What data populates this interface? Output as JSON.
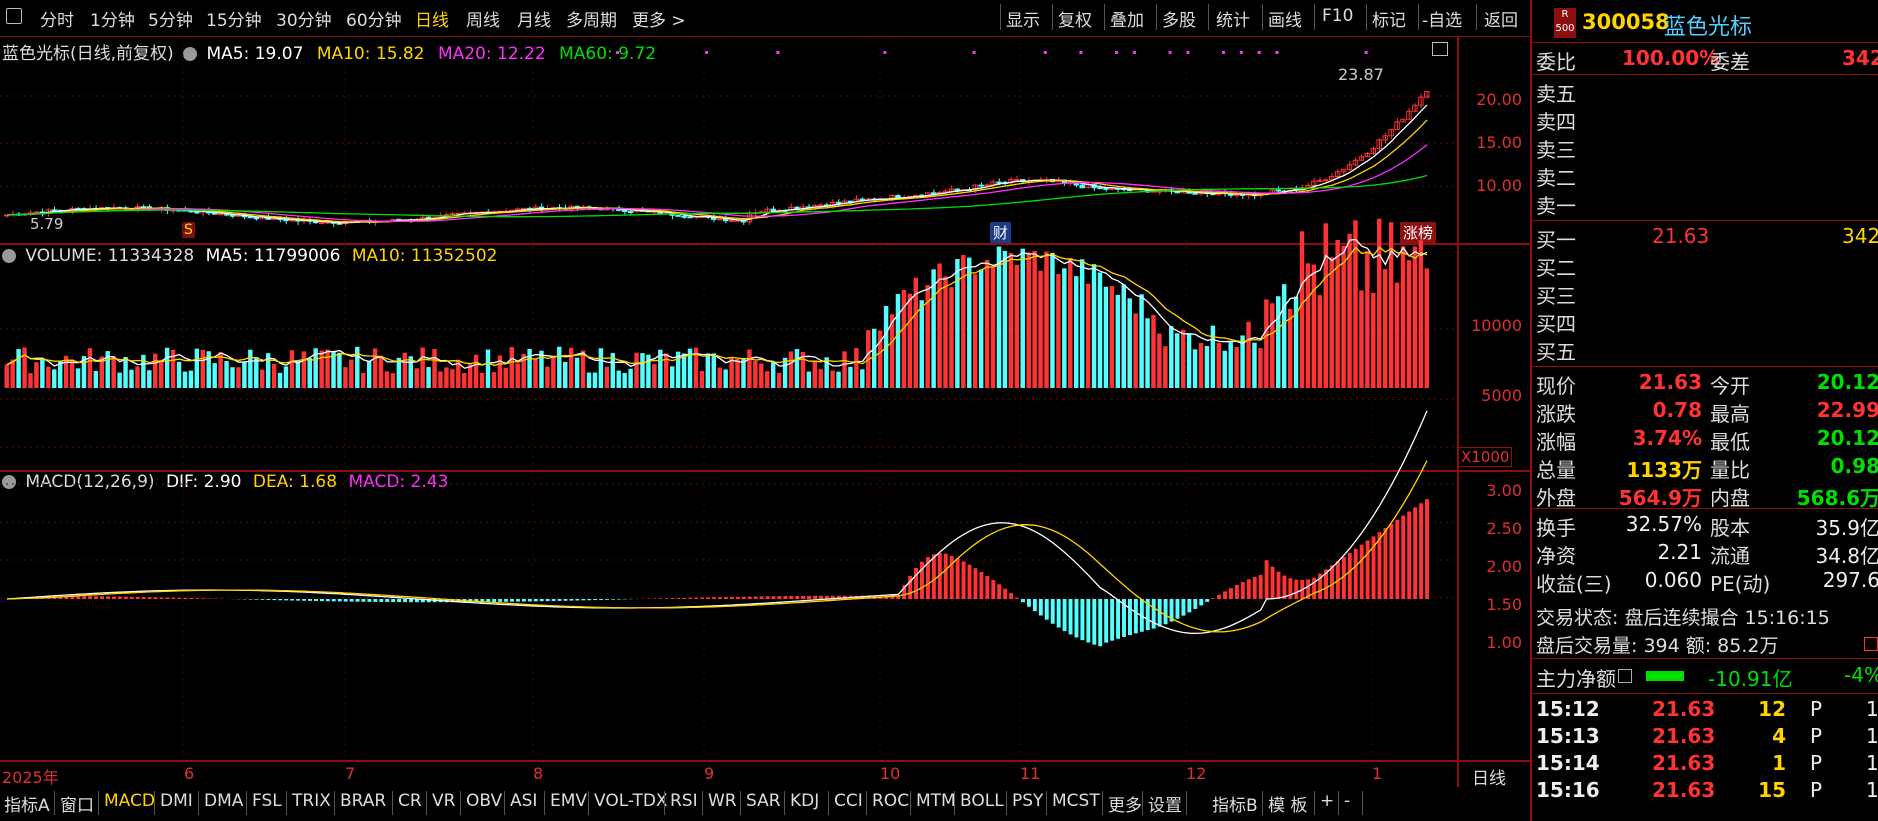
{
  "toolbar": {
    "periods": [
      "分时",
      "1分钟",
      "5分钟",
      "15分钟",
      "30分钟",
      "60分钟",
      "日线",
      "周线",
      "月线",
      "多周期",
      "更多 >"
    ],
    "active_period": "日线",
    "actions": [
      "显示",
      "复权",
      "叠加",
      "多股",
      "统计",
      "画线",
      "F10",
      "标记",
      "-自选",
      "返回"
    ]
  },
  "price_panel": {
    "title": "蓝色光标(日线,前复权)",
    "ma5": "MA5: 19.07",
    "ma10": "MA10: 15.82",
    "ma20": "MA20: 12.22",
    "ma60": "MA60: 9.72",
    "axis": [
      "20.00",
      "15.00",
      "10.00"
    ],
    "high_label": "23.87",
    "low_label": "5.79",
    "marker_s": "S",
    "marker_cai": "财",
    "marker_zhangbang": "涨榜"
  },
  "volume_panel": {
    "legend": "VOLUME: 11334328",
    "ma5": "MA5: 11799006",
    "ma10": "MA10: 11352502",
    "axis": [
      "10000",
      "5000"
    ],
    "unit": "X1000"
  },
  "macd_panel": {
    "legend": "MACD(12,26,9)",
    "dif": "DIF: 2.90",
    "dea": "DEA: 1.68",
    "macd": "MACD: 2.43",
    "axis": [
      "3.00",
      "2.50",
      "2.00",
      "1.50",
      "1.00"
    ]
  },
  "time_axis": {
    "labels": [
      "2025年",
      "6",
      "7",
      "8",
      "9",
      "10",
      "11",
      "12",
      "1"
    ],
    "period_label": "日线"
  },
  "bottom_tabs": [
    "指标A",
    "窗口",
    "MACD",
    "DMI",
    "DMA",
    "FSL",
    "TRIX",
    "BRAR",
    "CR",
    "VR",
    "OBV",
    "ASI",
    "EMV",
    "VOL-TDX",
    "RSI",
    "WR",
    "SAR",
    "KDJ",
    "CCI",
    "ROC",
    "MTM",
    "BOLL",
    "PSY",
    "MCST",
    "更多",
    "设置",
    "指标B",
    "模 板",
    "+",
    "-"
  ],
  "bottom_active": "MACD",
  "right_panel": {
    "badge_top": "R",
    "badge_bottom": "500",
    "code": "300058",
    "name": "蓝色光标",
    "weibi_label": "委比",
    "weibi_value": "100.00%",
    "weicha_label": "委差",
    "weicha_value": "342",
    "sell_labels": [
      "卖五",
      "卖四",
      "卖三",
      "卖二",
      "卖一"
    ],
    "buy": [
      {
        "label": "买一",
        "price": "21.63",
        "vol": "342"
      },
      {
        "label": "买二",
        "price": "",
        "vol": ""
      },
      {
        "label": "买三",
        "price": "",
        "vol": ""
      },
      {
        "label": "买四",
        "price": "",
        "vol": ""
      },
      {
        "label": "买五",
        "price": "",
        "vol": ""
      }
    ],
    "quote_rows": [
      {
        "l1": "现价",
        "v1": "21.63",
        "l2": "今开",
        "v2": "20.12",
        "c1": "red",
        "c2": "grn"
      },
      {
        "l1": "涨跌",
        "v1": "0.78",
        "l2": "最高",
        "v2": "22.99",
        "c1": "red",
        "c2": "red"
      },
      {
        "l1": "涨幅",
        "v1": "3.74%",
        "l2": "最低",
        "v2": "20.12",
        "c1": "red",
        "c2": "grn"
      },
      {
        "l1": "总量",
        "v1": "1133万",
        "l2": "量比",
        "v2": "0.98",
        "c1": "yel",
        "c2": "grn"
      },
      {
        "l1": "外盘",
        "v1": "564.9万",
        "l2": "内盘",
        "v2": "568.6万",
        "c1": "red",
        "c2": "grn"
      }
    ],
    "info_rows": [
      {
        "l1": "换手",
        "v1": "32.57%",
        "l2": "股本",
        "v2": "35.9亿"
      },
      {
        "l1": "净资",
        "v1": "2.21",
        "l2": "流通",
        "v2": "34.8亿"
      },
      {
        "l1": "收益(三)",
        "v1": "0.060",
        "l2": "PE(动)",
        "v2": "297.6"
      }
    ],
    "trade_status": "交易状态: 盘后连续撮合 15:16:15",
    "after_trade": "盘后交易量: 394  额: 85.2万",
    "main_net_label": "主力净额",
    "main_net_value": "-10.91亿",
    "main_net_pct": "-4%",
    "ticks": [
      {
        "time": "15:12",
        "price": "21.63",
        "vol": "12",
        "flag": "P",
        "n": "1"
      },
      {
        "time": "15:13",
        "price": "21.63",
        "vol": "4",
        "flag": "P",
        "n": "1"
      },
      {
        "time": "15:14",
        "price": "21.63",
        "vol": "1",
        "flag": "P",
        "n": "1"
      },
      {
        "time": "15:16",
        "price": "21.63",
        "vol": "15",
        "flag": "P",
        "n": "1"
      }
    ]
  },
  "colors": {
    "up": "#ff3333",
    "down": "#54ffff",
    "ma5": "#ffffff",
    "ma10": "#ffd400",
    "ma20": "#ff30ff",
    "ma60": "#00e000",
    "frame": "#8b0f0f"
  }
}
